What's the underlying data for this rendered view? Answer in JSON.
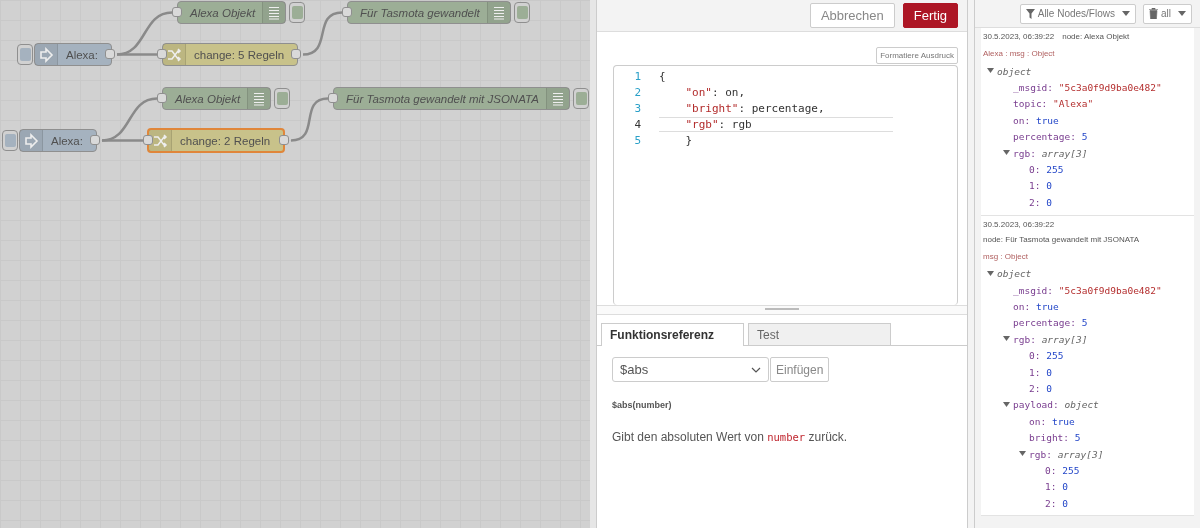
{
  "canvas": {
    "nodes": [
      {
        "kind": "inject",
        "label": "Alexa:",
        "selected": false
      },
      {
        "kind": "debug",
        "label": "Alexa Objekt",
        "selected": false
      },
      {
        "kind": "change",
        "label": "change: 5 Regeln",
        "selected": false
      },
      {
        "kind": "debug",
        "label": "Für Tasmota gewandelt",
        "selected": false
      },
      {
        "kind": "inject",
        "label": "Alexa:",
        "selected": false
      },
      {
        "kind": "debug",
        "label": "Alexa Objekt",
        "selected": false
      },
      {
        "kind": "change",
        "label": "change: 2 Regeln",
        "selected": true
      },
      {
        "kind": "debug",
        "label": "Für Tasmota gewandelt mit JSONATA",
        "selected": false
      }
    ]
  },
  "editor": {
    "buttons": [
      {
        "label": "Abbrechen",
        "kind": "secondary"
      },
      {
        "label": "Fertig",
        "kind": "primary"
      }
    ],
    "format_button": "Formatiere Ausdruck",
    "code_lines": [
      {
        "number": "1",
        "active": false,
        "tokens": [
          {
            "kind": "plain",
            "text": "{"
          }
        ]
      },
      {
        "number": "2",
        "active": false,
        "tokens": [
          {
            "kind": "string",
            "text": "    \"on\""
          },
          {
            "kind": "plain",
            "text": ": on,"
          }
        ]
      },
      {
        "number": "3",
        "active": false,
        "tokens": [
          {
            "kind": "string",
            "text": "    \"bright\""
          },
          {
            "kind": "plain",
            "text": ": percentage,"
          }
        ]
      },
      {
        "number": "4",
        "active": true,
        "tokens": [
          {
            "kind": "string",
            "text": "    \"rgb\""
          },
          {
            "kind": "plain",
            "text": ": rgb"
          }
        ]
      },
      {
        "number": "5",
        "active": false,
        "tokens": [
          {
            "kind": "plain",
            "text": "    }"
          }
        ]
      }
    ],
    "tabs": [
      {
        "label": "Funktionsreferenz",
        "selected": true
      },
      {
        "label": "Test",
        "selected": false
      }
    ],
    "function_select": "$abs",
    "insert_button": "Einfügen",
    "signature": "$abs(number)",
    "description": [
      {
        "kind": "text",
        "text": "Gibt den absoluten Wert von "
      },
      {
        "kind": "code",
        "text": "number"
      },
      {
        "kind": "text",
        "text": " zurück."
      }
    ]
  },
  "debug": {
    "filter": "Alle Nodes/Flows",
    "clear": "all",
    "messages": [
      {
        "time": "30.5.2023, 06:39:22",
        "node": "node: Alexa Objekt",
        "meta": "Alexa : msg : Object",
        "tree": {
          "value": "object",
          "expanded": true,
          "children": [
            {
              "key": "_msgid:",
              "value": "\"5c3a0f9d9ba0e482\"",
              "kind": "string"
            },
            {
              "key": "topic:",
              "value": "\"Alexa\"",
              "kind": "string"
            },
            {
              "key": "on:",
              "value": "true",
              "kind": "number"
            },
            {
              "key": "percentage:",
              "value": "5",
              "kind": "number"
            },
            {
              "key": "rgb:",
              "value": "array[3]",
              "kind": "meta",
              "expanded": true,
              "children": [
                {
                  "key": "0:",
                  "value": "255",
                  "kind": "number"
                },
                {
                  "key": "1:",
                  "value": "0",
                  "kind": "number"
                },
                {
                  "key": "2:",
                  "value": "0",
                  "kind": "number"
                }
              ]
            }
          ]
        }
      },
      {
        "time": "30.5.2023, 06:39:22",
        "node": "node: Für Tasmota gewandelt mit JSONATA",
        "meta": "msg : Object",
        "tree": {
          "value": "object",
          "expanded": true,
          "children": [
            {
              "key": "_msgid:",
              "value": "\"5c3a0f9d9ba0e482\"",
              "kind": "string"
            },
            {
              "key": "on:",
              "value": "true",
              "kind": "number"
            },
            {
              "key": "percentage:",
              "value": "5",
              "kind": "number"
            },
            {
              "key": "rgb:",
              "value": "array[3]",
              "kind": "meta",
              "expanded": true,
              "children": [
                {
                  "key": "0:",
                  "value": "255",
                  "kind": "number"
                },
                {
                  "key": "1:",
                  "value": "0",
                  "kind": "number"
                },
                {
                  "key": "2:",
                  "value": "0",
                  "kind": "number"
                }
              ]
            },
            {
              "key": "payload:",
              "value": "object",
              "kind": "meta",
              "expanded": true,
              "children": [
                {
                  "key": "on:",
                  "value": "true",
                  "kind": "number"
                },
                {
                  "key": "bright:",
                  "value": "5",
                  "kind": "number"
                },
                {
                  "key": "rgb:",
                  "value": "array[3]",
                  "kind": "meta",
                  "expanded": true,
                  "children": [
                    {
                      "key": "0:",
                      "value": "255",
                      "kind": "number"
                    },
                    {
                      "key": "1:",
                      "value": "0",
                      "kind": "number"
                    },
                    {
                      "key": "2:",
                      "value": "0",
                      "kind": "number"
                    }
                  ]
                }
              ]
            }
          ]
        }
      }
    ]
  }
}
